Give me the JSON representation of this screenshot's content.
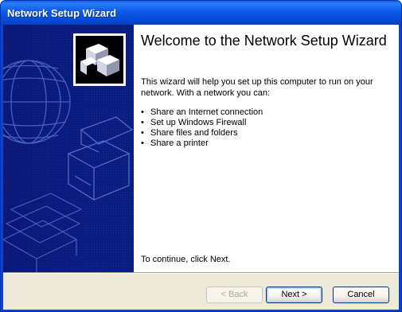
{
  "window": {
    "title": "Network Setup Wizard",
    "accent_color": "#0842d6",
    "sidebar_color": "#0a1a7a"
  },
  "content": {
    "heading": "Welcome to the Network Setup Wizard",
    "intro": "This wizard will help you set up this computer to run on your network. With a network you can:",
    "bullet_glyph": "•",
    "bullets": [
      "Share an Internet connection",
      "Set up Windows Firewall",
      "Share files and folders",
      "Share a printer"
    ],
    "continue_text": "To continue, click Next."
  },
  "buttons": {
    "back": "< Back",
    "next": "Next >",
    "cancel": "Cancel"
  },
  "icons": {
    "wizard_logo": "network-computers-icon"
  }
}
